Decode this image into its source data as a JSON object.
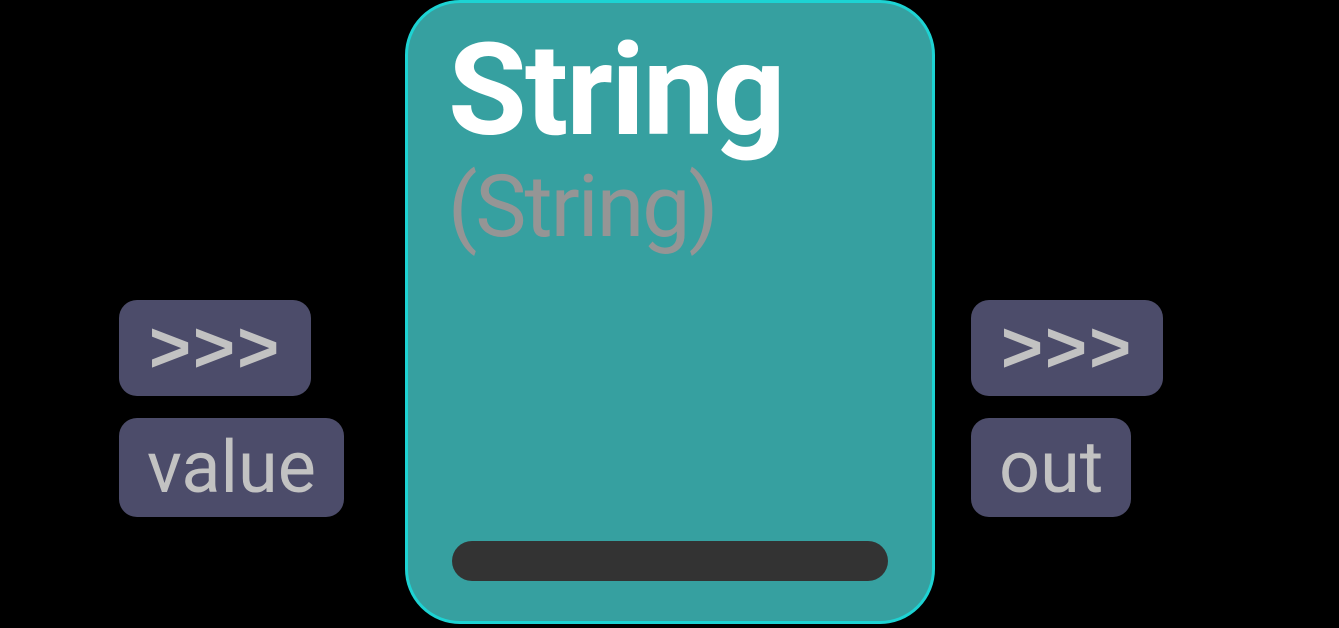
{
  "node": {
    "title": "String",
    "subtitle": "(String)"
  },
  "ports": {
    "input": {
      "exec": ">>>",
      "label": "value"
    },
    "output": {
      "exec": ">>>",
      "label": "out"
    }
  },
  "colors": {
    "node_bg": "#36a0a0",
    "node_border": "#1dd3d3",
    "port_bg": "#4c4c6a",
    "port_text": "#c2c2c2",
    "input_bar": "#333333"
  }
}
